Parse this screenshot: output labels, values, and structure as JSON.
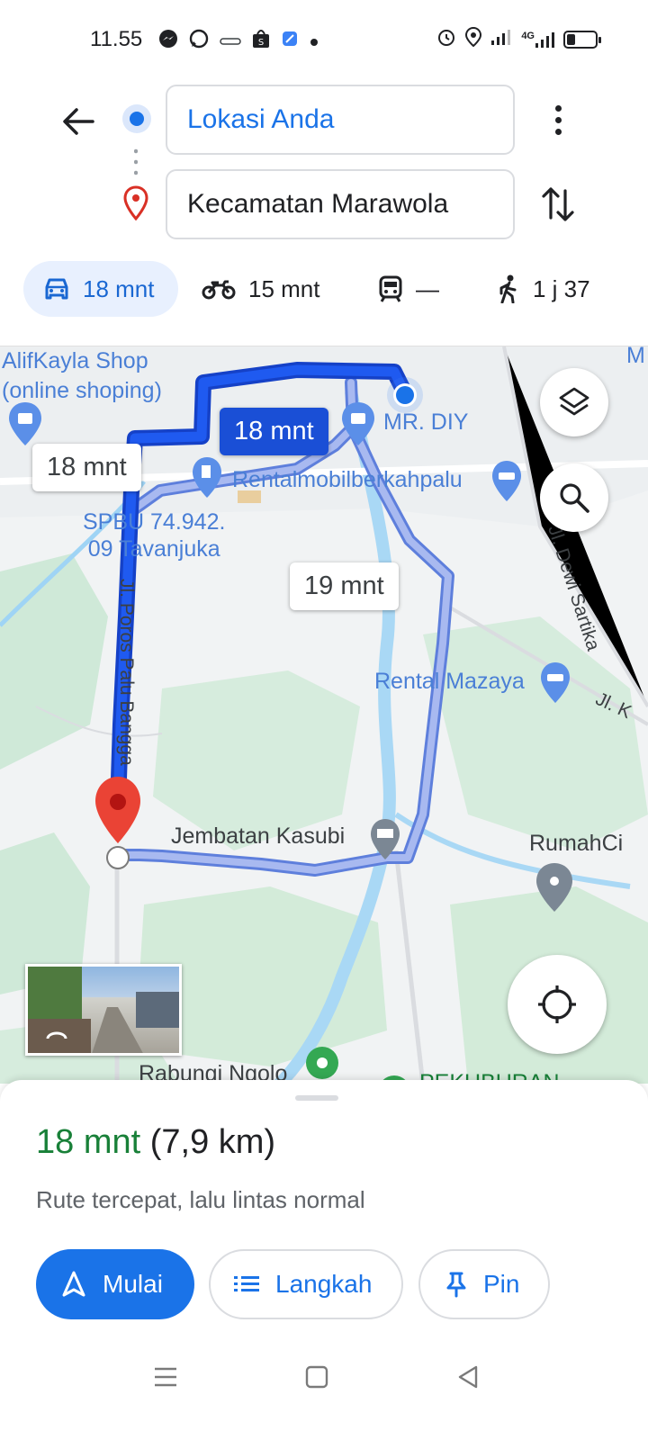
{
  "status_bar": {
    "time": "11.55",
    "left_icons": [
      "messenger-icon",
      "whatsapp-icon",
      "app-icon",
      "shopee-icon",
      "app-icon",
      "dot-icon"
    ],
    "right_icons": [
      "alarm-icon",
      "location-icon",
      "signal-icon",
      "4g-signal-icon",
      "battery-icon"
    ],
    "network_label": "4G"
  },
  "search": {
    "origin": "Lokasi Anda",
    "destination": "Kecamatan Marawola"
  },
  "modes": [
    {
      "name": "car",
      "label": "18 mnt",
      "active": true
    },
    {
      "name": "motorcycle",
      "label": "15 mnt",
      "active": false
    },
    {
      "name": "transit",
      "label": "—",
      "active": false
    },
    {
      "name": "walk",
      "label": "1 j 37",
      "active": false
    }
  ],
  "map": {
    "labels": {
      "shop": "AlifKayla Shop\n(online shoping)",
      "mr_diy": "MR. DIY",
      "rental1": "Rentalmobilberkahpalu",
      "spbu": "SPBU 74.942.\n09 Tavanjuka",
      "street_poros": "Jl. Poros Palu Bangga",
      "street_dewi": "Jl. Dewi Sartika",
      "rental2": "Rental Mazaya",
      "street_k": "Jl. K",
      "bridge": "Jembatan Kasubi",
      "rumah": "RumahCi",
      "rabungi": "Rabungi Ngolo",
      "pekuburan": "PEKUBURAN",
      "edge_m": "M"
    },
    "route_times": {
      "primary_on_route": "18 mnt",
      "primary_side": "18 mnt",
      "alternative": "19 mnt"
    }
  },
  "sheet": {
    "duration": "18 mnt",
    "distance": "(7,9 km)",
    "subtitle": "Rute tercepat, lalu lintas normal",
    "start_label": "Mulai",
    "steps_label": "Langkah",
    "pin_label": "Pin"
  },
  "colors": {
    "accent": "#1a73e8",
    "route_primary": "#1a4fd6",
    "route_alt": "#a8b9f0",
    "duration_green": "#188038",
    "pin_red": "#ea4335"
  }
}
